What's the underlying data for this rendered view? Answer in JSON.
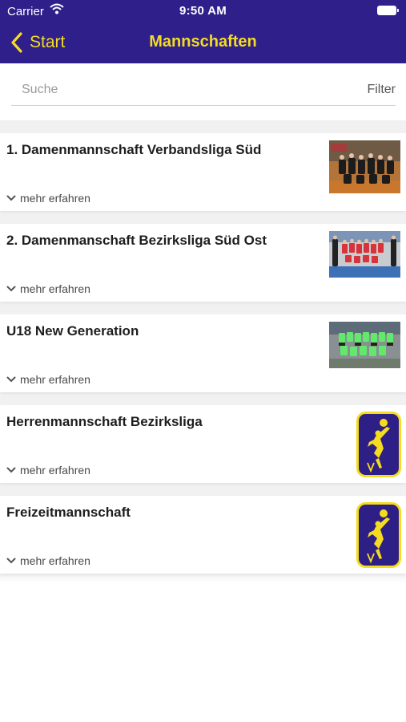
{
  "status_bar": {
    "carrier": "Carrier",
    "time": "9:50 AM"
  },
  "nav": {
    "back_label": "Start",
    "title": "Mannschaften"
  },
  "search": {
    "placeholder": "Suche",
    "value": "",
    "filter_label": "Filter"
  },
  "colors": {
    "header_bg": "#2f1f8a",
    "accent_yellow": "#f5dc1e"
  },
  "teams": [
    {
      "title": "1. Damenmannschaft Verbandsliga Süd",
      "more_label": "mehr erfahren",
      "image": "team-photo"
    },
    {
      "title": "2. Damenmanschaft Bezirksliga Süd Ost",
      "more_label": "mehr erfahren",
      "image": "team-photo"
    },
    {
      "title": "U18 New Generation",
      "more_label": "mehr erfahren",
      "image": "team-photo"
    },
    {
      "title": "Herrenmannschaft Bezirksliga",
      "more_label": "mehr erfahren",
      "image": "club-logo"
    },
    {
      "title": "Freizeitmannschaft",
      "more_label": "mehr erfahren",
      "image": "club-logo"
    }
  ]
}
